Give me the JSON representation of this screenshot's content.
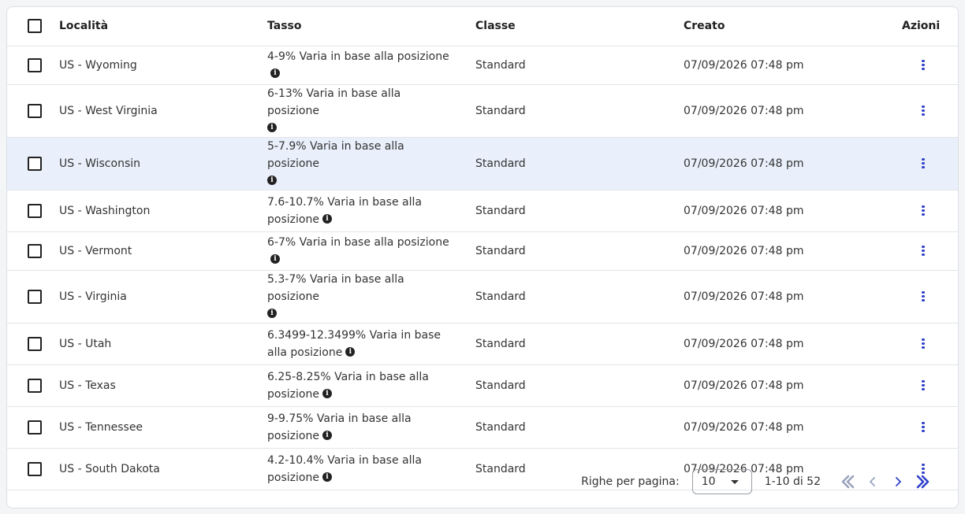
{
  "table": {
    "headers": {
      "location": "Località",
      "rate": "Tasso",
      "class": "Classe",
      "created": "Creato",
      "actions": "Azioni"
    },
    "rows": [
      {
        "location": "US - Wyoming",
        "rate": "4-9% Varia in base alla posizione",
        "class": "Standard",
        "created": "07/09/2026 07:48 pm"
      },
      {
        "location": "US - West Virginia",
        "rate": "6-13% Varia in base alla posizione",
        "class": "Standard",
        "created": "07/09/2026 07:48 pm"
      },
      {
        "location": "US - Wisconsin",
        "rate": "5-7.9% Varia in base alla posizione",
        "class": "Standard",
        "created": "07/09/2026 07:48 pm"
      },
      {
        "location": "US - Washington",
        "rate": "7.6-10.7% Varia in base alla posizione",
        "class": "Standard",
        "created": "07/09/2026 07:48 pm"
      },
      {
        "location": "US - Vermont",
        "rate": "6-7% Varia in base alla posizione",
        "class": "Standard",
        "created": "07/09/2026 07:48 pm"
      },
      {
        "location": "US - Virginia",
        "rate": "5.3-7% Varia in base alla posizione",
        "class": "Standard",
        "created": "07/09/2026 07:48 pm"
      },
      {
        "location": "US - Utah",
        "rate": "6.3499-12.3499% Varia in base alla posizione",
        "class": "Standard",
        "created": "07/09/2026 07:48 pm"
      },
      {
        "location": "US - Texas",
        "rate": "6.25-8.25% Varia in base alla posizione",
        "class": "Standard",
        "created": "07/09/2026 07:48 pm"
      },
      {
        "location": "US - Tennessee",
        "rate": "9-9.75% Varia in base alla posizione",
        "class": "Standard",
        "created": "07/09/2026 07:48 pm"
      },
      {
        "location": "US - South Dakota",
        "rate": "4.2-10.4% Varia in base alla posizione",
        "class": "Standard",
        "created": "07/09/2026 07:48 pm"
      }
    ]
  },
  "pagination": {
    "rows_per_page_label": "Righe per pagina:",
    "rows_per_page_value": "10",
    "range": "1-10 di 52"
  },
  "colors": {
    "accent": "#2f3fc8",
    "highlight_row": "#e9f0fb",
    "border": "#dcdfe4"
  },
  "icons": {
    "checkbox": "checkbox-icon",
    "info": "info-icon",
    "actions": "kebab-menu-icon",
    "first_page": "double-chevron-left-icon",
    "prev_page": "chevron-left-icon",
    "next_page": "chevron-right-icon",
    "last_page": "double-chevron-right-icon",
    "dropdown": "caret-down-icon"
  }
}
